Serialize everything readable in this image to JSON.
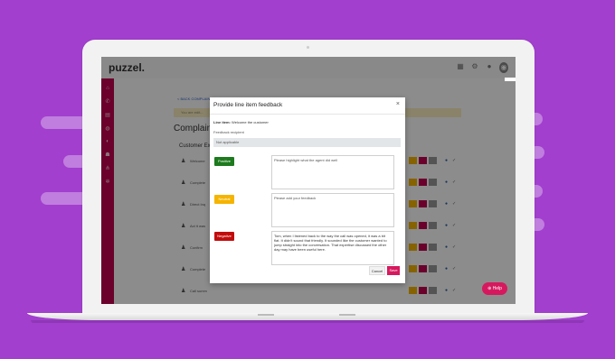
{
  "colors": {
    "background": "#a23fce",
    "sidebar": "#c1004f",
    "accent": "#d6195e",
    "positive": "#1e7a1e",
    "neutral": "#f5b400",
    "negative": "#c20c0c"
  },
  "app": {
    "logo": "puzzel.",
    "topbar_icons": [
      "grid-icon",
      "gear-icon",
      "bell-icon",
      "user-icon"
    ],
    "sidebar_icons": [
      "home-icon",
      "phone-icon",
      "document-icon",
      "settings-icon",
      "gauge-icon",
      "users-icon",
      "tree-icon",
      "gear-icon"
    ],
    "breadcrumb": "< BACK COMPLAINT",
    "notice": "You are edit...",
    "page_title": "Complaint",
    "section": "Customer Ex",
    "rows": [
      {
        "label": "Welcome"
      },
      {
        "label": "Complete"
      },
      {
        "label": "Direct Inq"
      },
      {
        "label": "Act it was"
      },
      {
        "label": "Confirm"
      },
      {
        "label": "Complete"
      },
      {
        "label": "Call summ"
      }
    ],
    "help": "⊕ Help"
  },
  "modal": {
    "title": "Provide line item feedback",
    "close": "×",
    "line_item_label": "Line item:",
    "line_item_value": "Welcome the customer",
    "recipient_label": "Feedback recipient",
    "recipient_value": "Not applicable",
    "feedback": [
      {
        "button": "Positive",
        "placeholder": "Please highlight what the agent did well",
        "text": ""
      },
      {
        "button": "Neutral",
        "placeholder": "Please add your feedback",
        "text": ""
      },
      {
        "button": "Negative",
        "placeholder": "",
        "text": "Tom, when I listened back to the way the call was opened, it was a bit flat. It didn't sound that friendly. It sounded like the customer wanted to jump straight into the conversation. That expertise discussed the other day may have been useful here."
      }
    ],
    "cancel": "Cancel",
    "save": "Save"
  }
}
